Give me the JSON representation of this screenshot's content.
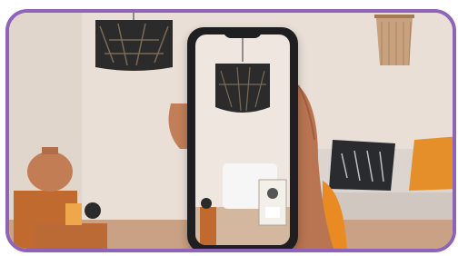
{
  "scene": {
    "border_color": "#8e63b8",
    "wall_color": "#e9dfd6",
    "floor_color": "#c9a184",
    "accent_orange": "#e98a23",
    "objects": [
      "pendant-lamp",
      "macrame-wall-hanging",
      "sofa",
      "pillows",
      "side-table",
      "vase",
      "candle",
      "smartphone",
      "hand"
    ]
  },
  "phone_screen": {
    "items": [
      "pendant-lamp",
      "radiator",
      "photo-frame",
      "side-table"
    ]
  }
}
